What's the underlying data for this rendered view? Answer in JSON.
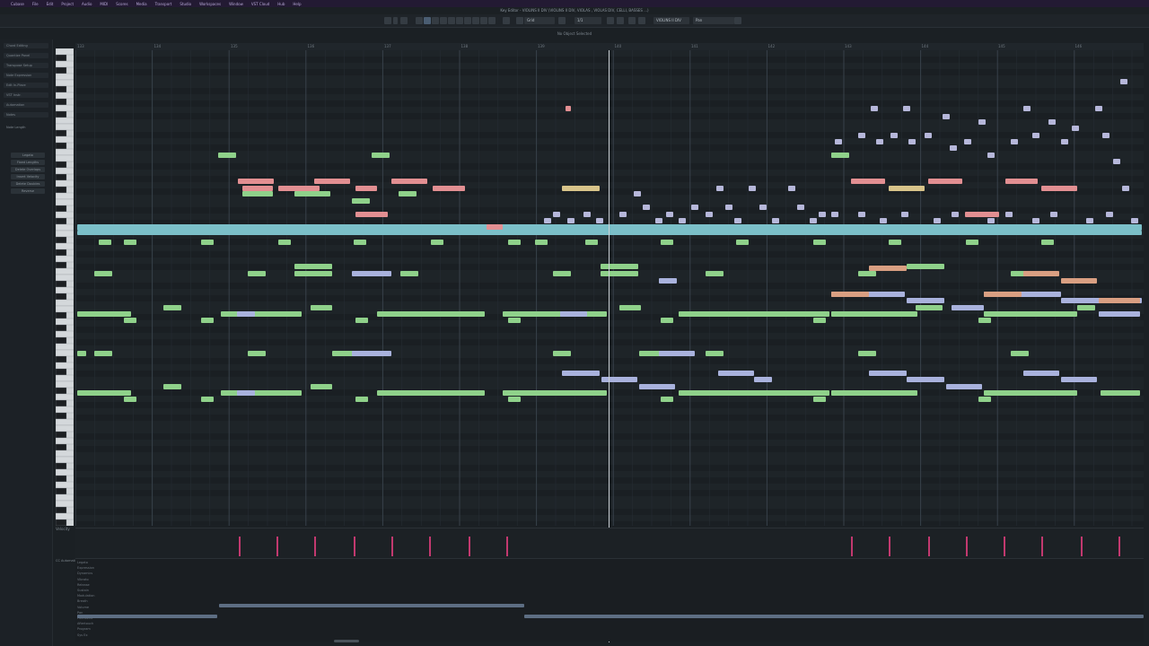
{
  "menubar": {
    "items": [
      "Cubase",
      "File",
      "Edit",
      "Project",
      "Audio",
      "MIDI",
      "Scores",
      "Media",
      "Transport",
      "Studio",
      "Workspaces",
      "Window",
      "VST Cloud",
      "Hub",
      "Help"
    ]
  },
  "window": {
    "title": "Key Editor - VIOLINS II DIV (VIOLINS II DIV, VIOLAS , VIOLAS DIV, CELLI, BASSES ...)"
  },
  "toolbar": {
    "quantize": "Grid",
    "length": "1/1",
    "track": "VIOLINS II DIV",
    "controller": "Pan"
  },
  "info_line": "No Object Selected",
  "left_panel": {
    "sections": [
      "Chord Editing",
      "Quantize Panel",
      "Transpose Setup",
      "Note Expression",
      "Edit In-Place",
      "VST Instr.",
      "Automation",
      "Notes"
    ],
    "buttons": [
      "Legato",
      "Fixed Lengths",
      "Delete Overlaps",
      "Insert Velocity",
      "Delete Doubles",
      "Reverse"
    ],
    "note_length_label": "Note Length"
  },
  "ruler": {
    "bars": [
      "133",
      "134",
      "135",
      "136",
      "137",
      "138",
      "139",
      "140",
      "141",
      "142",
      "143",
      "144",
      "145",
      "146"
    ]
  },
  "velocity_lane": {
    "label": "Velocity"
  },
  "automation": {
    "label": "CC Automation",
    "lanes": [
      "Legato",
      "Expression",
      "Dynamics",
      "Vibrato",
      "Release",
      "Sustain",
      "Modulation",
      "Breath",
      "Volume",
      "Pan",
      "Pitchbend",
      "Aftertouch",
      "Program",
      "Sys Ex"
    ]
  },
  "colors": {
    "green": "#8fd18a",
    "blue": "#a9b2dd",
    "red": "#e28f92",
    "teal": "#7bbfc8",
    "yellow": "#d8c48a",
    "velocity": "#c2396f"
  }
}
